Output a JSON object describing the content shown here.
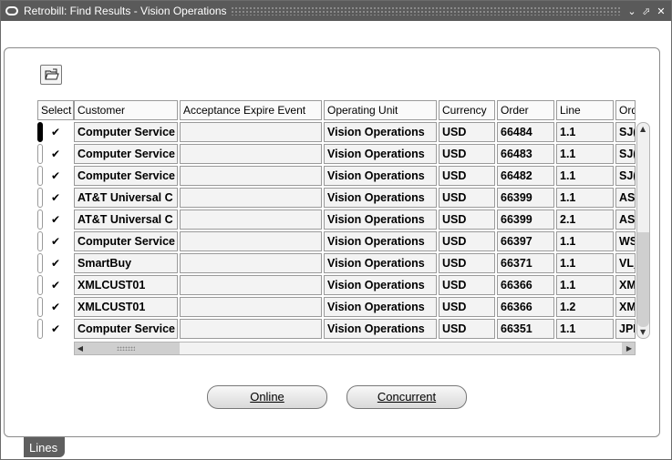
{
  "window": {
    "title": "Retrobill: Find Results - Vision Operations",
    "buttons": [
      "minimize-icon",
      "maximize-icon",
      "close-icon"
    ]
  },
  "table": {
    "headers": [
      "Select",
      "Customer",
      "Acceptance Expire Event",
      "Operating Unit",
      "Currency",
      "Order",
      "Line",
      "Ord"
    ],
    "rows": [
      {
        "checked": true,
        "customer": "Computer Service",
        "acceptance": "",
        "ou": "Vision Operations",
        "currency": "USD",
        "order": "66484",
        "line": "1.1",
        "ord": "SJ("
      },
      {
        "checked": true,
        "customer": "Computer Service",
        "acceptance": "",
        "ou": "Vision Operations",
        "currency": "USD",
        "order": "66483",
        "line": "1.1",
        "ord": "SJ("
      },
      {
        "checked": true,
        "customer": "Computer Service",
        "acceptance": "",
        "ou": "Vision Operations",
        "currency": "USD",
        "order": "66482",
        "line": "1.1",
        "ord": "SJ("
      },
      {
        "checked": true,
        "customer": "AT&T Universal C",
        "acceptance": "",
        "ou": "Vision Operations",
        "currency": "USD",
        "order": "66399",
        "line": "1.1",
        "ord": "AS"
      },
      {
        "checked": true,
        "customer": "AT&T Universal C",
        "acceptance": "",
        "ou": "Vision Operations",
        "currency": "USD",
        "order": "66399",
        "line": "2.1",
        "ord": "AS"
      },
      {
        "checked": true,
        "customer": "Computer Service",
        "acceptance": "",
        "ou": "Vision Operations",
        "currency": "USD",
        "order": "66397",
        "line": "1.1",
        "ord": "WS"
      },
      {
        "checked": true,
        "customer": "SmartBuy",
        "acceptance": "",
        "ou": "Vision Operations",
        "currency": "USD",
        "order": "66371",
        "line": "1.1",
        "ord": "VL_"
      },
      {
        "checked": true,
        "customer": "XMLCUST01",
        "acceptance": "",
        "ou": "Vision Operations",
        "currency": "USD",
        "order": "66366",
        "line": "1.1",
        "ord": "XM"
      },
      {
        "checked": true,
        "customer": "XMLCUST01",
        "acceptance": "",
        "ou": "Vision Operations",
        "currency": "USD",
        "order": "66366",
        "line": "1.2",
        "ord": "XM"
      },
      {
        "checked": true,
        "customer": "Computer Service",
        "acceptance": "",
        "ou": "Vision Operations",
        "currency": "USD",
        "order": "66351",
        "line": "1.1",
        "ord": "JPI"
      }
    ],
    "current_row": 0
  },
  "buttons": {
    "online_label": "Online",
    "concurrent_label": "Concurrent"
  },
  "tabs": {
    "lines_label": "Lines"
  },
  "icons": {
    "toolbar": "folder-open-icon"
  }
}
